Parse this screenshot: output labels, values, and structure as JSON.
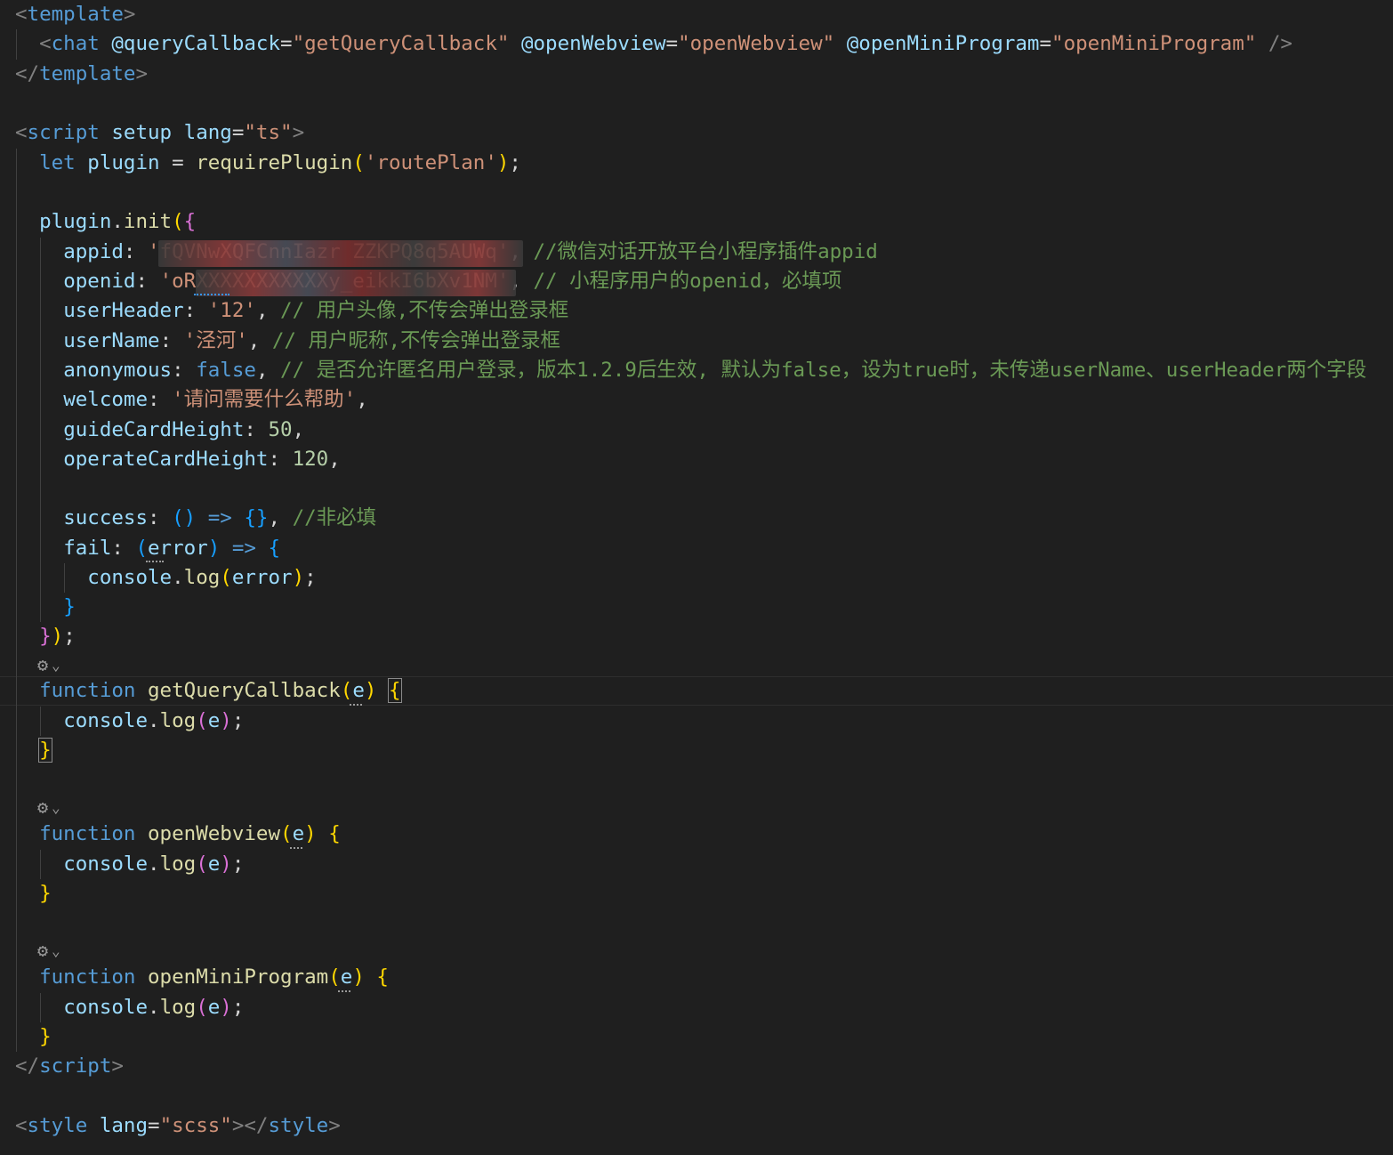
{
  "colors": {
    "background": "#1f1f1f",
    "tag_bracket": "#808080",
    "tag_name": "#569cd6",
    "attribute": "#9cdcfe",
    "string": "#ce9178",
    "keyword": "#569cd6",
    "function": "#dcdcaa",
    "variable": "#9cdcfe",
    "comment": "#6a9955",
    "number": "#b5cea8",
    "punctuation": "#d4d4d4",
    "bracket_gold": "#ffd700",
    "bracket_purple": "#da70d6",
    "bracket_blue": "#179fff"
  },
  "code_lines": [
    [
      [
        "<",
        "tb"
      ],
      [
        "template",
        "tn"
      ],
      [
        ">",
        "tb"
      ]
    ],
    [
      [
        "  ",
        "p"
      ],
      [
        "<",
        "tb"
      ],
      [
        "chat",
        "tn"
      ],
      [
        " ",
        "p"
      ],
      [
        "@queryCallback",
        "at"
      ],
      [
        "=",
        "p"
      ],
      [
        "\"getQueryCallback\"",
        "st"
      ],
      [
        " ",
        "p"
      ],
      [
        "@openWebview",
        "at"
      ],
      [
        "=",
        "p"
      ],
      [
        "\"openWebview\"",
        "st"
      ],
      [
        " ",
        "p"
      ],
      [
        "@openMiniProgram",
        "at"
      ],
      [
        "=",
        "p"
      ],
      [
        "\"openMiniProgram\"",
        "st"
      ],
      [
        " />",
        "tb"
      ]
    ],
    [
      [
        "</",
        "tb"
      ],
      [
        "template",
        "tn"
      ],
      [
        ">",
        "tb"
      ]
    ],
    [],
    [
      [
        "<",
        "tb"
      ],
      [
        "script",
        "tn"
      ],
      [
        " ",
        "p"
      ],
      [
        "setup",
        "at"
      ],
      [
        " ",
        "p"
      ],
      [
        "lang",
        "at"
      ],
      [
        "=",
        "p"
      ],
      [
        "\"ts\"",
        "st"
      ],
      [
        ">",
        "tb"
      ]
    ],
    [
      [
        "  ",
        "p"
      ],
      [
        "let",
        "kw"
      ],
      [
        " ",
        "p"
      ],
      [
        "plugin",
        "vr"
      ],
      [
        " = ",
        "p"
      ],
      [
        "requirePlugin",
        "fn"
      ],
      [
        "(",
        "b1"
      ],
      [
        "'routePlan'",
        "st"
      ],
      [
        ")",
        "b1"
      ],
      [
        ";",
        "p"
      ]
    ],
    [],
    [
      [
        "  ",
        "p"
      ],
      [
        "plugin",
        "vr"
      ],
      [
        ".",
        "p"
      ],
      [
        "init",
        "fn"
      ],
      [
        "(",
        "b1"
      ],
      [
        "{",
        "b2"
      ]
    ],
    [
      [
        "    ",
        "p"
      ],
      [
        "appid",
        "vr"
      ],
      [
        ": ",
        "p"
      ],
      [
        "'fQVNwXQFCnnIazr ZZKPQ8q5AUWq'",
        "st"
      ],
      [
        ", ",
        "p"
      ],
      [
        "//微信对话开放平台小程序插件appid",
        "cm"
      ]
    ],
    [
      [
        "    ",
        "p"
      ],
      [
        "openid",
        "vr"
      ],
      [
        ": ",
        "p"
      ],
      [
        "'oRXXXXXXXXXXXy_eikkI6bXv1NM'",
        "st"
      ],
      [
        ", ",
        "p"
      ],
      [
        "// 小程序用户的openid，必填项",
        "cm"
      ]
    ],
    [
      [
        "    ",
        "p"
      ],
      [
        "userHeader",
        "vr"
      ],
      [
        ": ",
        "p"
      ],
      [
        "'12'",
        "st"
      ],
      [
        ", ",
        "p"
      ],
      [
        "// 用户头像,不传会弹出登录框",
        "cm"
      ]
    ],
    [
      [
        "    ",
        "p"
      ],
      [
        "userName",
        "vr"
      ],
      [
        ": ",
        "p"
      ],
      [
        "'泾河'",
        "st"
      ],
      [
        ", ",
        "p"
      ],
      [
        "// 用户昵称,不传会弹出登录框",
        "cm"
      ]
    ],
    [
      [
        "    ",
        "p"
      ],
      [
        "anonymous",
        "vr"
      ],
      [
        ": ",
        "p"
      ],
      [
        "false",
        "kw"
      ],
      [
        ", ",
        "p"
      ],
      [
        "// 是否允许匿名用户登录，版本1.2.9后生效, 默认为false，设为true时，未传递userName、userHeader两个字段",
        "cm"
      ]
    ],
    [
      [
        "    ",
        "p"
      ],
      [
        "welcome",
        "vr"
      ],
      [
        ": ",
        "p"
      ],
      [
        "'请问需要什么帮助'",
        "st"
      ],
      [
        ",",
        "p"
      ]
    ],
    [
      [
        "    ",
        "p"
      ],
      [
        "guideCardHeight",
        "vr"
      ],
      [
        ": ",
        "p"
      ],
      [
        "50",
        "nm"
      ],
      [
        ",",
        "p"
      ]
    ],
    [
      [
        "    ",
        "p"
      ],
      [
        "operateCardHeight",
        "vr"
      ],
      [
        ": ",
        "p"
      ],
      [
        "120",
        "nm"
      ],
      [
        ",",
        "p"
      ]
    ],
    [],
    [
      [
        "    ",
        "p"
      ],
      [
        "success",
        "vr"
      ],
      [
        ": ",
        "p"
      ],
      [
        "()",
        "b3"
      ],
      [
        " ",
        "p"
      ],
      [
        "=>",
        "kw"
      ],
      [
        " ",
        "p"
      ],
      [
        "{}",
        "b3"
      ],
      [
        ", ",
        "p"
      ],
      [
        "//非必填",
        "cm"
      ]
    ],
    [
      [
        "    ",
        "p"
      ],
      [
        "fail",
        "vr"
      ],
      [
        ": ",
        "p"
      ],
      [
        "(",
        "b3"
      ],
      [
        "error",
        "vr"
      ],
      [
        ")",
        "b3"
      ],
      [
        " ",
        "p"
      ],
      [
        "=>",
        "kw"
      ],
      [
        " ",
        "p"
      ],
      [
        "{",
        "b3"
      ]
    ],
    [
      [
        "      ",
        "p"
      ],
      [
        "console",
        "vr"
      ],
      [
        ".",
        "p"
      ],
      [
        "log",
        "fn"
      ],
      [
        "(",
        "b1"
      ],
      [
        "error",
        "vr"
      ],
      [
        ")",
        "b1"
      ],
      [
        ";",
        "p"
      ]
    ],
    [
      [
        "    ",
        "p"
      ],
      [
        "}",
        "b3"
      ]
    ],
    [
      [
        "  ",
        "p"
      ],
      [
        "}",
        "b2"
      ],
      [
        ")",
        "b1"
      ],
      [
        ";",
        "p"
      ]
    ],
    [],
    [
      [
        "  ",
        "p"
      ],
      [
        "function",
        "kw"
      ],
      [
        " ",
        "p"
      ],
      [
        "getQueryCallback",
        "fn"
      ],
      [
        "(",
        "b1"
      ],
      [
        "e",
        "vr"
      ],
      [
        ")",
        "b1"
      ],
      [
        " ",
        "p"
      ],
      [
        "{",
        "b1"
      ]
    ],
    [
      [
        "    ",
        "p"
      ],
      [
        "console",
        "vr"
      ],
      [
        ".",
        "p"
      ],
      [
        "log",
        "fn"
      ],
      [
        "(",
        "b2"
      ],
      [
        "e",
        "vr"
      ],
      [
        ")",
        "b2"
      ],
      [
        ";",
        "p"
      ]
    ],
    [
      [
        "  ",
        "p"
      ],
      [
        "}",
        "b1"
      ]
    ],
    [],
    [],
    [
      [
        "  ",
        "p"
      ],
      [
        "function",
        "kw"
      ],
      [
        " ",
        "p"
      ],
      [
        "openWebview",
        "fn"
      ],
      [
        "(",
        "b1"
      ],
      [
        "e",
        "vr"
      ],
      [
        ")",
        "b1"
      ],
      [
        " ",
        "p"
      ],
      [
        "{",
        "b1"
      ]
    ],
    [
      [
        "    ",
        "p"
      ],
      [
        "console",
        "vr"
      ],
      [
        ".",
        "p"
      ],
      [
        "log",
        "fn"
      ],
      [
        "(",
        "b2"
      ],
      [
        "e",
        "vr"
      ],
      [
        ")",
        "b2"
      ],
      [
        ";",
        "p"
      ]
    ],
    [
      [
        "  ",
        "p"
      ],
      [
        "}",
        "b1"
      ]
    ],
    [],
    [],
    [
      [
        "  ",
        "p"
      ],
      [
        "function",
        "kw"
      ],
      [
        " ",
        "p"
      ],
      [
        "openMiniProgram",
        "fn"
      ],
      [
        "(",
        "b1"
      ],
      [
        "e",
        "vr"
      ],
      [
        ")",
        "b1"
      ],
      [
        " ",
        "p"
      ],
      [
        "{",
        "b1"
      ]
    ],
    [
      [
        "    ",
        "p"
      ],
      [
        "console",
        "vr"
      ],
      [
        ".",
        "p"
      ],
      [
        "log",
        "fn"
      ],
      [
        "(",
        "b2"
      ],
      [
        "e",
        "vr"
      ],
      [
        ")",
        "b2"
      ],
      [
        ";",
        "p"
      ]
    ],
    [
      [
        "  ",
        "p"
      ],
      [
        "}",
        "b1"
      ]
    ],
    [
      [
        "</",
        "tb"
      ],
      [
        "script",
        "tn"
      ],
      [
        ">",
        "tb"
      ]
    ],
    [],
    [
      [
        "<",
        "tb"
      ],
      [
        "style",
        "tn"
      ],
      [
        " ",
        "p"
      ],
      [
        "lang",
        "at"
      ],
      [
        "=",
        "p"
      ],
      [
        "\"scss\"",
        "st"
      ],
      [
        "></",
        "tb"
      ],
      [
        "style",
        "tn"
      ],
      [
        ">",
        "tb"
      ]
    ]
  ],
  "codelens_icon": "copilot-sparkle-icon",
  "codelens_chevron": "⌄",
  "codelens_glyph": "⚙"
}
